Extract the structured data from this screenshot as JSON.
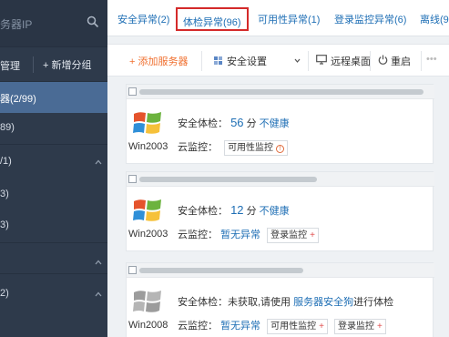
{
  "sidebar": {
    "search_placeholder": "务器IP",
    "manage_label": "管理",
    "add_group_label": "+ 新增分组",
    "groups": [
      {
        "label": "器(2/99)",
        "selected": true,
        "chevron": false
      },
      {
        "label": "89)",
        "selected": false,
        "chevron": false
      },
      {
        "label": "/1)",
        "selected": false,
        "chevron": true
      },
      {
        "label": "3)",
        "selected": false,
        "chevron": false
      },
      {
        "label": "3)",
        "selected": false,
        "chevron": false
      },
      {
        "label": "",
        "selected": false,
        "chevron": true
      },
      {
        "label": "2)",
        "selected": false,
        "chevron": true
      }
    ]
  },
  "tabs": [
    {
      "label": "安全异常(2)",
      "active": false
    },
    {
      "label": "体检异常(96)",
      "active": true
    },
    {
      "label": "可用性异常(1)",
      "active": false
    },
    {
      "label": "登录监控异常(6)",
      "active": false
    },
    {
      "label": "离线(97",
      "active": false
    }
  ],
  "toolbar": {
    "add_server": "+ 添加服务器",
    "security_settings": "安全设置",
    "remote_desktop": "远程桌面",
    "restart": "重启"
  },
  "servers": [
    {
      "os": "Win2003",
      "check_label": "安全体检：",
      "score": "56",
      "score_unit": "分",
      "status": "不健康",
      "monitor_label": "云监控：",
      "monitor_status": "",
      "tags": [
        {
          "label": "可用性监控",
          "warn": true,
          "plus": false
        }
      ]
    },
    {
      "os": "Win2003",
      "check_label": "安全体检：",
      "score": "12",
      "score_unit": "分",
      "status": "不健康",
      "monitor_label": "云监控：",
      "monitor_status": "暂无异常",
      "tags": [
        {
          "label": "登录监控",
          "warn": false,
          "plus": true
        }
      ]
    },
    {
      "os": "Win2008",
      "check_label": "安全体检：",
      "check_text": "未获取,请使用",
      "check_link": "服务器安全狗",
      "check_suffix": "进行体检",
      "monitor_label": "云监控：",
      "monitor_status": "暂无异常",
      "tags": [
        {
          "label": "可用性监控",
          "warn": false,
          "plus": true
        },
        {
          "label": "登录监控",
          "warn": false,
          "plus": true
        }
      ]
    }
  ],
  "colors": {
    "sidebar_bg": "#2e3a4b",
    "sidebar_selected": "#4a6b95",
    "link_blue": "#1f6fb5",
    "add_orange": "#f07030",
    "active_tab_border": "#d42a2a"
  }
}
